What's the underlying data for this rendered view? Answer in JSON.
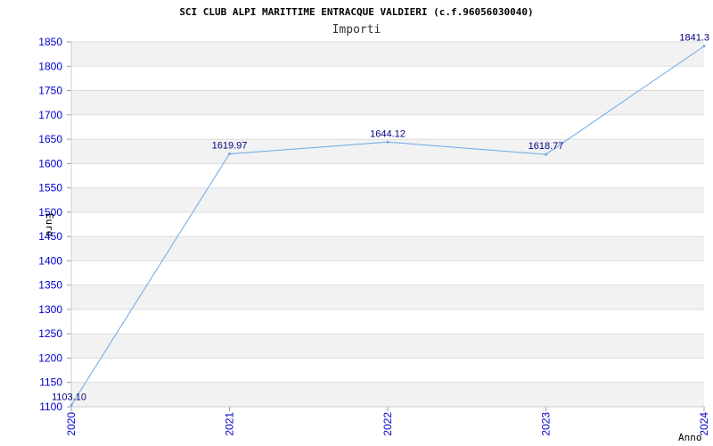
{
  "chart_data": {
    "type": "line",
    "title": "SCI CLUB ALPI MARITTIME ENTRACQUE VALDIERI (c.f.96056030040)",
    "subtitle": "Importi",
    "xlabel": "Anno",
    "ylabel": "Euro",
    "x": [
      "2020",
      "2021",
      "2022",
      "2023",
      "2024"
    ],
    "series": [
      {
        "values": [
          1103.1,
          1619.97,
          1644.12,
          1618.77,
          1841.3
        ],
        "labels": [
          "1103.10",
          "1619.97",
          "1644.12",
          "1618.77",
          "1841.3"
        ]
      }
    ],
    "ylim": [
      1100,
      1850
    ],
    "ytick_step": 50,
    "grid": "horizontal bands",
    "colors": {
      "line": "#6aaae8",
      "ticks": "#0000cc",
      "labels": "#000080",
      "band": "#f2f2f2",
      "grid": "#dddddd"
    }
  }
}
